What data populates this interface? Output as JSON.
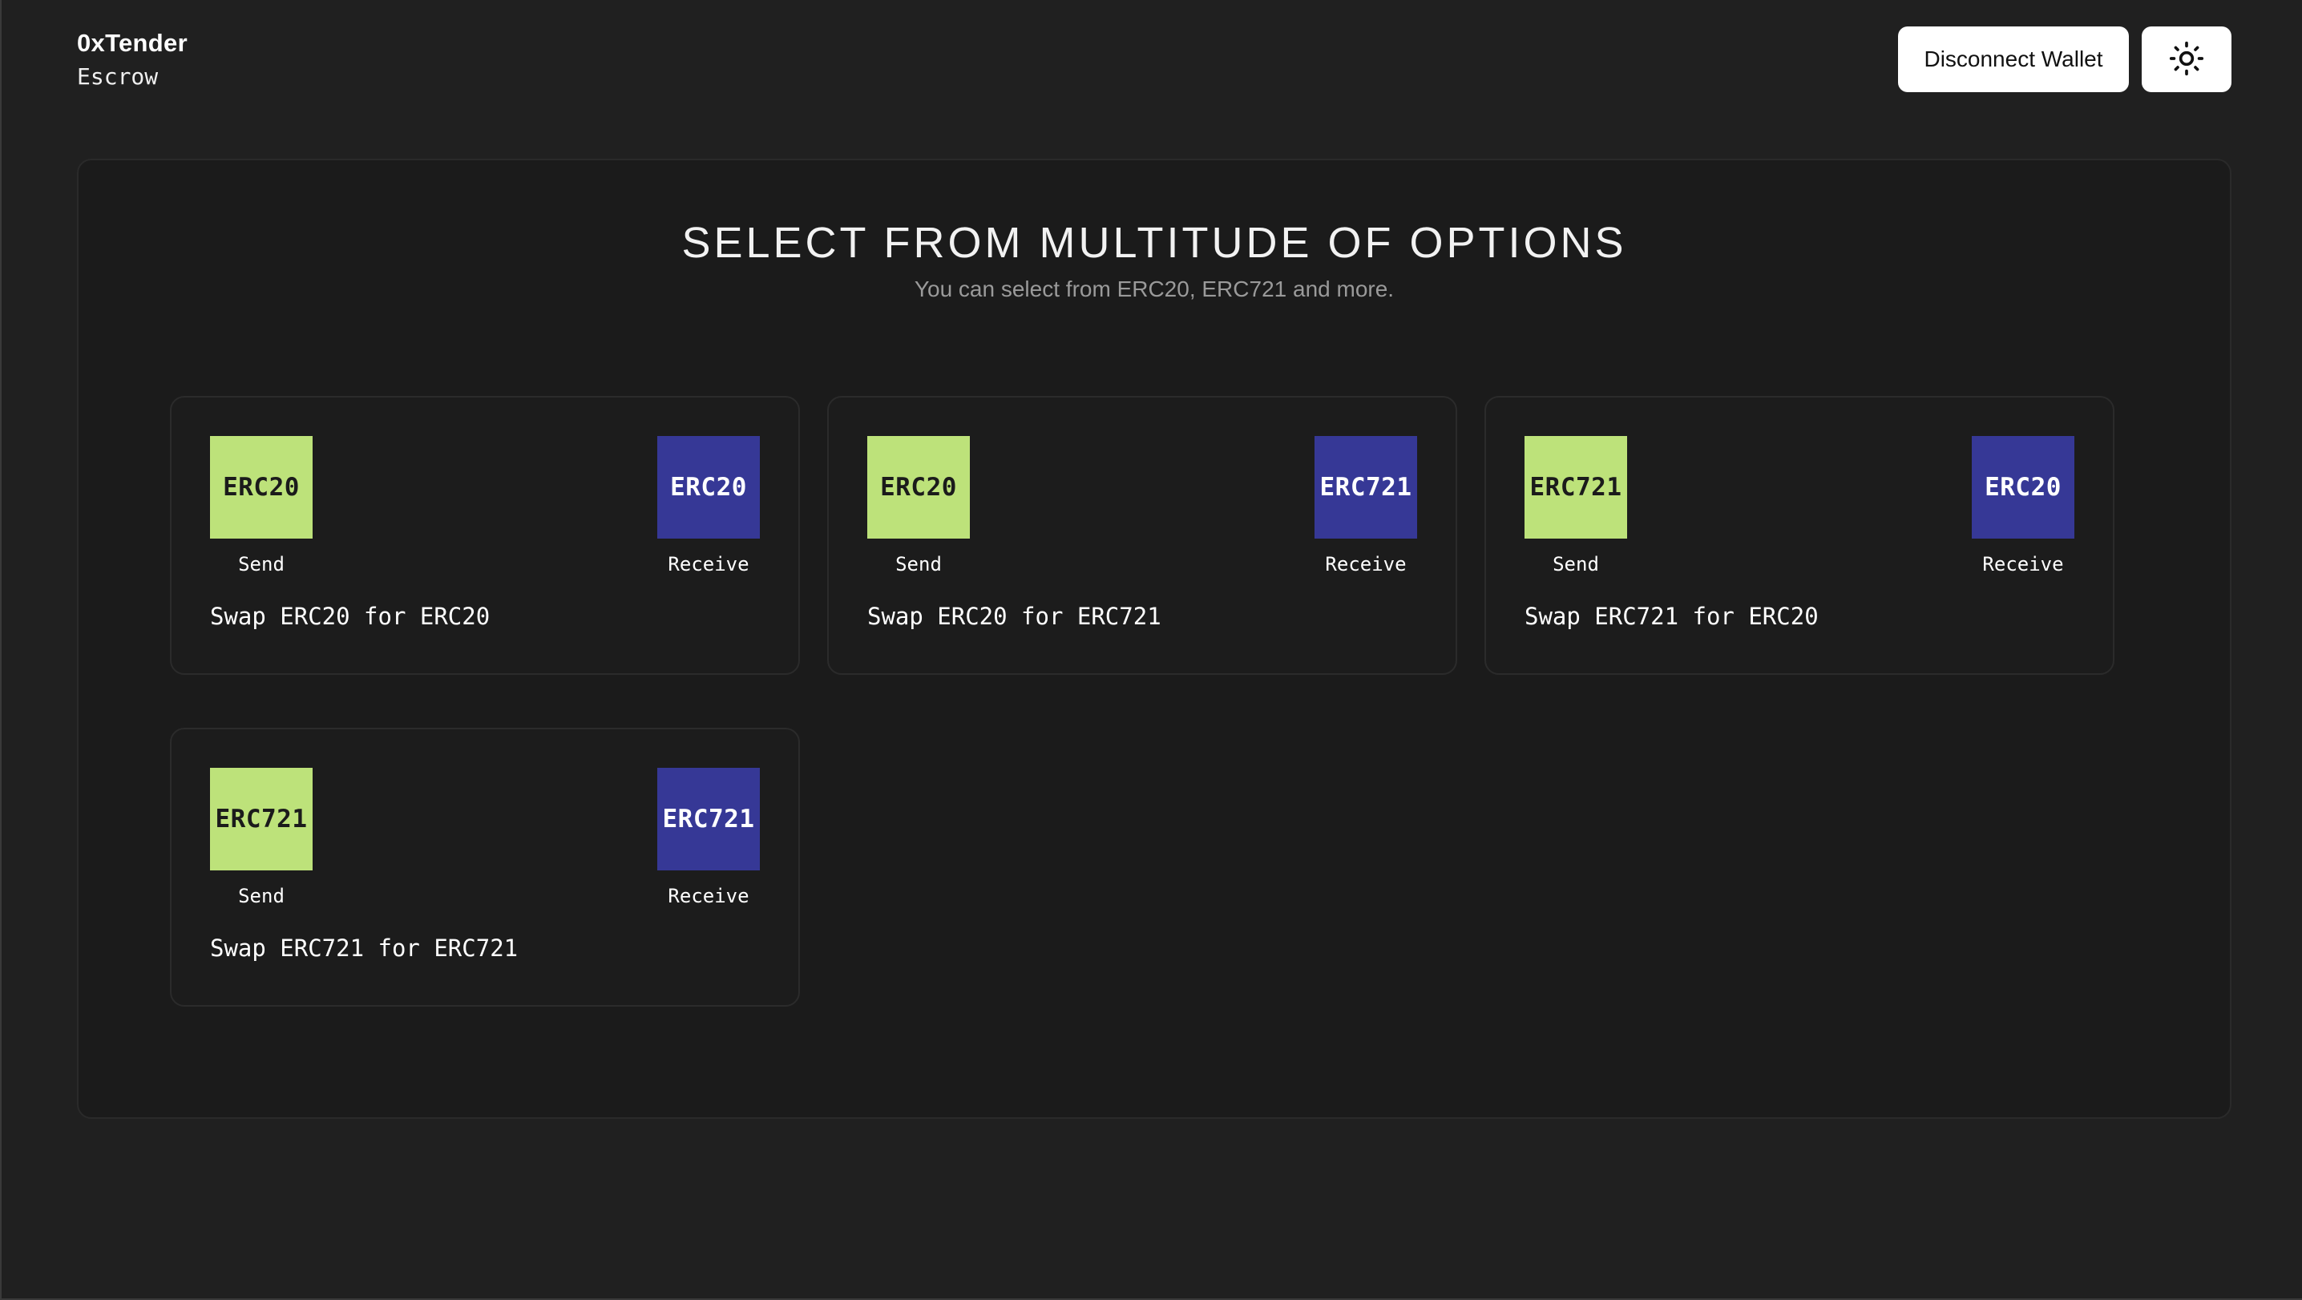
{
  "header": {
    "brand_name": "0xTender",
    "brand_sub": "Escrow",
    "disconnect_label": "Disconnect Wallet",
    "theme_icon": "sun-icon"
  },
  "main": {
    "title": "SELECT FROM MULTITUDE OF OPTIONS",
    "subtitle": "You can select from ERC20, ERC721 and more."
  },
  "colors": {
    "background": "#202020",
    "panel": "#1b1b1b",
    "send_tile": "#bde27a",
    "receive_tile": "#363896",
    "button": "#ffffff"
  },
  "cards": [
    {
      "send_token": "ERC20",
      "send_label": "Send",
      "receive_token": "ERC20",
      "receive_label": "Receive",
      "title": "Swap ERC20 for ERC20"
    },
    {
      "send_token": "ERC20",
      "send_label": "Send",
      "receive_token": "ERC721",
      "receive_label": "Receive",
      "title": "Swap ERC20 for ERC721"
    },
    {
      "send_token": "ERC721",
      "send_label": "Send",
      "receive_token": "ERC20",
      "receive_label": "Receive",
      "title": "Swap ERC721 for ERC20"
    },
    {
      "send_token": "ERC721",
      "send_label": "Send",
      "receive_token": "ERC721",
      "receive_label": "Receive",
      "title": "Swap ERC721 for ERC721"
    }
  ]
}
